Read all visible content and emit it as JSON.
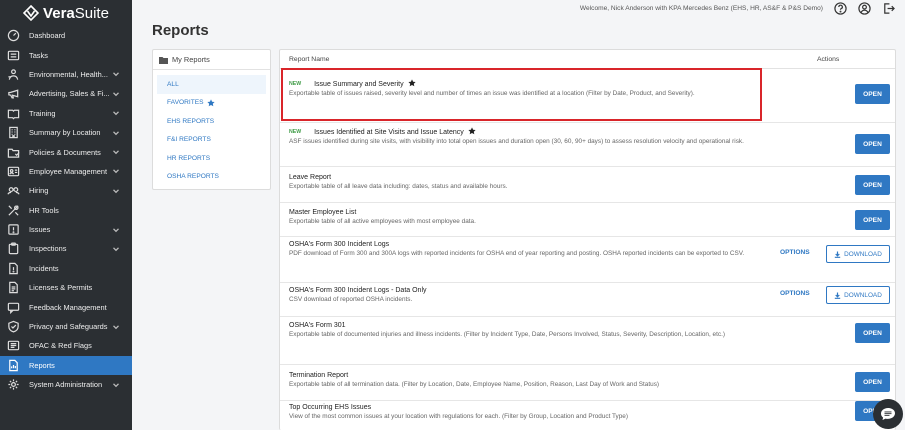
{
  "app": {
    "brand_left": "Vera",
    "brand_right": "Suite",
    "welcome": "Welcome, Nick Anderson with KPA Mercedes Benz (EHS, HR, AS&F & P&S Demo)"
  },
  "sidebar": {
    "items": [
      {
        "label": "Dashboard",
        "icon": "dashboard-icon",
        "chevron": false
      },
      {
        "label": "Tasks",
        "icon": "tasks-icon",
        "chevron": false
      },
      {
        "label": "Environmental, Health...",
        "icon": "health-icon",
        "chevron": true
      },
      {
        "label": "Advertising, Sales & Fi...",
        "icon": "megaphone-icon",
        "chevron": true
      },
      {
        "label": "Training",
        "icon": "training-icon",
        "chevron": true
      },
      {
        "label": "Summary by Location",
        "icon": "building-icon",
        "chevron": true
      },
      {
        "label": "Policies & Documents",
        "icon": "folder-icon",
        "chevron": true
      },
      {
        "label": "Employee Management",
        "icon": "id-card-icon",
        "chevron": true
      },
      {
        "label": "Hiring",
        "icon": "hiring-icon",
        "chevron": true
      },
      {
        "label": "HR Tools",
        "icon": "tools-icon",
        "chevron": false
      },
      {
        "label": "Issues",
        "icon": "issues-icon",
        "chevron": true
      },
      {
        "label": "Inspections",
        "icon": "clipboard-icon",
        "chevron": true
      },
      {
        "label": "Incidents",
        "icon": "incident-icon",
        "chevron": false
      },
      {
        "label": "Licenses & Permits",
        "icon": "license-icon",
        "chevron": false
      },
      {
        "label": "Feedback Management",
        "icon": "feedback-icon",
        "chevron": false
      },
      {
        "label": "Privacy and Safeguards",
        "icon": "shield-icon",
        "chevron": true
      },
      {
        "label": "OFAC & Red Flags",
        "icon": "flag-icon",
        "chevron": false
      },
      {
        "label": "Reports",
        "icon": "reports-icon",
        "chevron": false,
        "active": true
      },
      {
        "label": "System Administration",
        "icon": "gear-icon",
        "chevron": true
      }
    ]
  },
  "page": {
    "title": "Reports"
  },
  "my_reports": {
    "title": "My Reports",
    "filters": [
      {
        "label": "ALL",
        "selected": true
      },
      {
        "label": "FAVORITES",
        "star": true
      },
      {
        "label": "EHS REPORTS"
      },
      {
        "label": "F&I REPORTS"
      },
      {
        "label": "HR REPORTS"
      },
      {
        "label": "OSHA REPORTS"
      }
    ]
  },
  "table": {
    "col_name": "Report Name",
    "col_actions": "Actions",
    "new_badge": "NEW",
    "open_label": "OPEN",
    "options_label": "OPTIONS",
    "download_label": "DOWNLOAD",
    "rows": [
      {
        "name": "Issue Summary and Severity",
        "new": true,
        "star": true,
        "action": "open",
        "desc": "Exportable table of issues raised, severity level and number of times an issue was identified at a location (Filter by Date, Product, and Severity)."
      },
      {
        "name": "Issues Identified at Site Visits and Issue Latency",
        "new": true,
        "star": true,
        "action": "open",
        "desc": "ASF issues identified during site visits, with visibility into total open issues and duration open (30, 60, 90+ days) to assess resolution velocity and operational risk."
      },
      {
        "name": "Leave Report",
        "action": "open",
        "desc": "Exportable table of all leave data including: dates, status and available hours."
      },
      {
        "name": "Master Employee List",
        "action": "open",
        "desc": "Exportable table of all active employees with most employee data."
      },
      {
        "name": "OSHA's Form 300 Incident Logs",
        "action": "download",
        "desc": "PDF download of Form 300 and 300A logs with reported incidents for OSHA end of year reporting and posting. OSHA reported incidents can be exported to CSV."
      },
      {
        "name": "OSHA's Form 300 Incident Logs - Data Only",
        "action": "download",
        "desc": "CSV download of reported OSHA incidents."
      },
      {
        "name": "OSHA's Form 301",
        "action": "open",
        "desc": "Exportable table of documented injuries and illness incidents. (Filter by Incident Type, Date, Persons Involved, Status, Severity, Description, Location, etc.)"
      },
      {
        "name": "Termination Report",
        "action": "open",
        "desc": "Exportable table of all termination data. (Filter by Location, Date, Employee Name, Position, Reason, Last Day of Work and Status)"
      },
      {
        "name": "Top Occurring EHS Issues",
        "action": "open",
        "desc": "View of the most common issues at your location with regulations for each. (Filter by Group, Location and Product Type)"
      }
    ]
  },
  "colors": {
    "sidebar_bg": "#2b2f33",
    "accent": "#2f78c3",
    "new_badge": "#3f9b46",
    "highlight": "#d9252a"
  }
}
